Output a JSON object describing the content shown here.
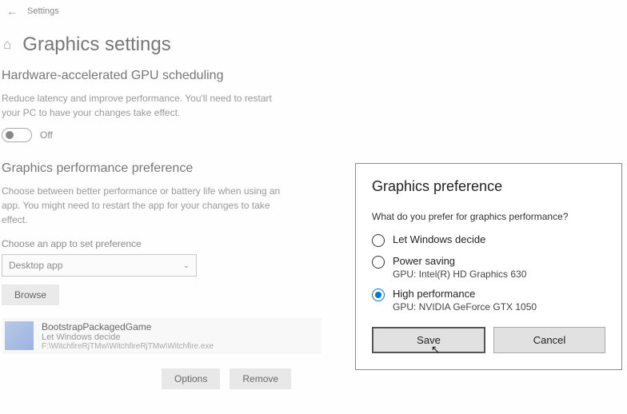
{
  "header": {
    "app": "Settings"
  },
  "page": {
    "title": "Graphics settings"
  },
  "gpu_sched": {
    "heading": "Hardware-accelerated GPU scheduling",
    "description": "Reduce latency and improve performance. You'll need to restart your PC to have your changes take effect.",
    "toggle_label": "Off"
  },
  "perf": {
    "heading": "Graphics performance preference",
    "description": "Choose between better performance or battery life when using an app. You might need to restart the app for your changes to take effect.",
    "chooser_label": "Choose an app to set preference",
    "dropdown_value": "Desktop app",
    "browse_label": "Browse"
  },
  "app": {
    "name": "BootstrapPackagedGame",
    "pref": "Let Windows decide",
    "path": "F:\\WitchfireRjTMw\\WitchfireRjTMw\\Witchfire.exe",
    "options_label": "Options",
    "remove_label": "Remove"
  },
  "dialog": {
    "title": "Graphics preference",
    "question": "What do you prefer for graphics performance?",
    "options": [
      {
        "label": "Let Windows decide",
        "sublabel": "",
        "selected": false
      },
      {
        "label": "Power saving",
        "sublabel": "GPU: Intel(R) HD Graphics 630",
        "selected": false
      },
      {
        "label": "High performance",
        "sublabel": "GPU: NVIDIA GeForce GTX 1050",
        "selected": true
      }
    ],
    "save_label": "Save",
    "cancel_label": "Cancel"
  }
}
